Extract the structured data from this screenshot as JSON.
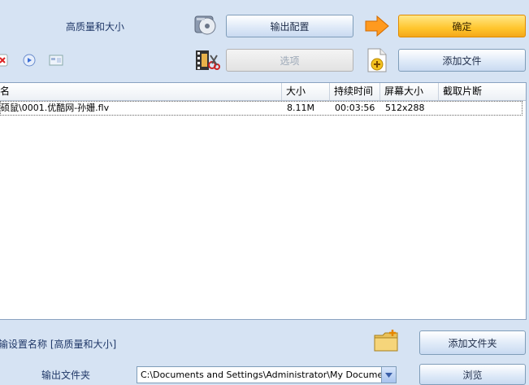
{
  "top": {
    "preset_label": "高质量和大小",
    "output_config_label": "输出配置",
    "confirm_label": "确定",
    "options_label": "选项",
    "add_file_label": "添加文件"
  },
  "table": {
    "headers": [
      "名",
      "大小",
      "持续时间",
      "屏幕大小",
      "截取片断"
    ],
    "rows": [
      {
        "name": "硕鼠\\0001.优酷网-孙姗.flv",
        "size": "8.11M",
        "duration": "00:03:56",
        "screen": "512x288",
        "clip": ""
      }
    ]
  },
  "bottom": {
    "preset_text": "输设置名称  [高质量和大小]",
    "add_folder_label": "添加文件夹",
    "output_folder_label": "输出文件夹",
    "output_path": "C:\\Documents and Settings\\Administrator\\My Documents\\FFO",
    "browse_label": "浏览"
  },
  "colors": {
    "accent": "#ffc62e",
    "background": "#d6e3f3",
    "text": "#203868"
  }
}
